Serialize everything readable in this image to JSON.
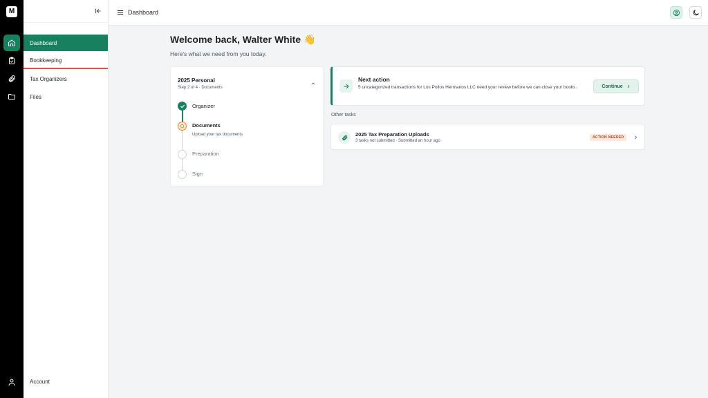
{
  "rail": {
    "logo_text": "M",
    "items": [
      {
        "icon": "home-icon",
        "active": true
      },
      {
        "icon": "clipboard-icon",
        "active": false
      },
      {
        "icon": "paperclip-icon",
        "active": false
      },
      {
        "icon": "folder-icon",
        "active": false
      }
    ],
    "account_icon": "person-icon"
  },
  "sidebar": {
    "collapse_icon": "collapse-left-icon",
    "items": [
      {
        "label": "Dashboard",
        "active": true
      },
      {
        "label": "Bookkeeping",
        "active": false
      },
      {
        "label": "Tax Organizers",
        "active": false
      },
      {
        "label": "Files",
        "active": false
      }
    ],
    "account_label": "Account"
  },
  "header": {
    "title": "Dashboard",
    "menu_icon": "hamburger-menu-icon",
    "user_icon": "user-circle-icon",
    "theme_icon": "moon-icon"
  },
  "main": {
    "welcome": "Welcome back, Walter White 👋",
    "subtitle": "Here's what we need from you today."
  },
  "progress": {
    "title": "2025 Personal",
    "subtitle": "Step 2 of 4 · Documents",
    "steps": [
      {
        "label": "Organizer",
        "status": "done",
        "desc": ""
      },
      {
        "label": "Documents",
        "status": "current",
        "desc": "Upload your tax documents"
      },
      {
        "label": "Preparation",
        "status": "todo",
        "desc": ""
      },
      {
        "label": "Sign",
        "status": "todo",
        "desc": ""
      }
    ]
  },
  "next_action": {
    "title": "Next action",
    "description": "5 uncategorized transactions for Los Pollos Hermanos LLC need your review before we can close your books.",
    "button_label": "Continue"
  },
  "other_tasks": {
    "label": "Other tasks",
    "items": [
      {
        "title": "2025 Tax Preparation Uploads",
        "subtitle": "3 tasks not submitted · Submitted an hour ago",
        "badge": "ACTION NEEDED"
      }
    ]
  },
  "colors": {
    "accent": "#16805f",
    "warning": "#e8872e",
    "badge_text": "#b4441b"
  }
}
